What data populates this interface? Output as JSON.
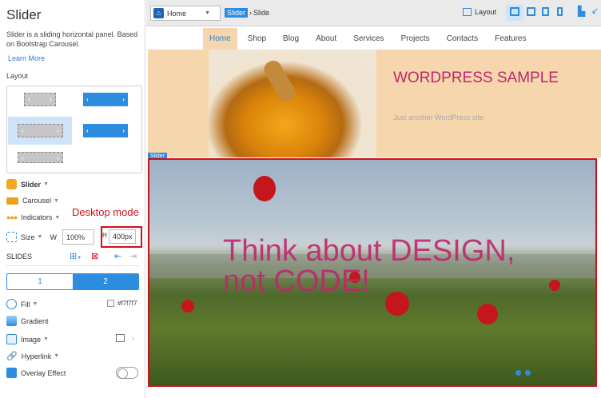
{
  "panel": {
    "title": "Slider",
    "description": "Slider is a sliding horizontal panel. Based on Bootstrap Carousel.",
    "learn_more": "Learn More",
    "layout_label": "Layout",
    "slider_label": "Slider",
    "carousel_label": "Carousel",
    "indicators_label": "Indicators",
    "size_label": "Size",
    "w_label": "W",
    "w_value": "100%",
    "h_label": "H",
    "h_value": "400px",
    "annotation": "Desktop mode",
    "slides_label": "SLIDES",
    "slide_tabs": [
      "1",
      "2"
    ],
    "fill_label": "Fill",
    "fill_value": "#f7f7f7",
    "gradient_label": "Gradient",
    "image_label": "Image",
    "hyperlink_label": "Hyperlink",
    "overlay_label": "Overlay Effect"
  },
  "toolbar": {
    "home_label": "Home",
    "crumb_tag": "Slider",
    "crumb_item": "Slide",
    "layout_label": "Layout"
  },
  "site": {
    "nav": [
      "Home",
      "Shop",
      "Blog",
      "About",
      "Services",
      "Projects",
      "Contacts",
      "Features"
    ],
    "title": "WORDPRESS SAMPLE",
    "subtitle": "Just another WordPress site",
    "slider_tag": "Slider",
    "slide_text": "Think about DESIGN, not CODE!"
  },
  "colors": {
    "accent": "#2b8ce0",
    "annotation_red": "#d0101a",
    "title_pink": "#c0266d",
    "hero_bg": "#f5d6ad"
  }
}
